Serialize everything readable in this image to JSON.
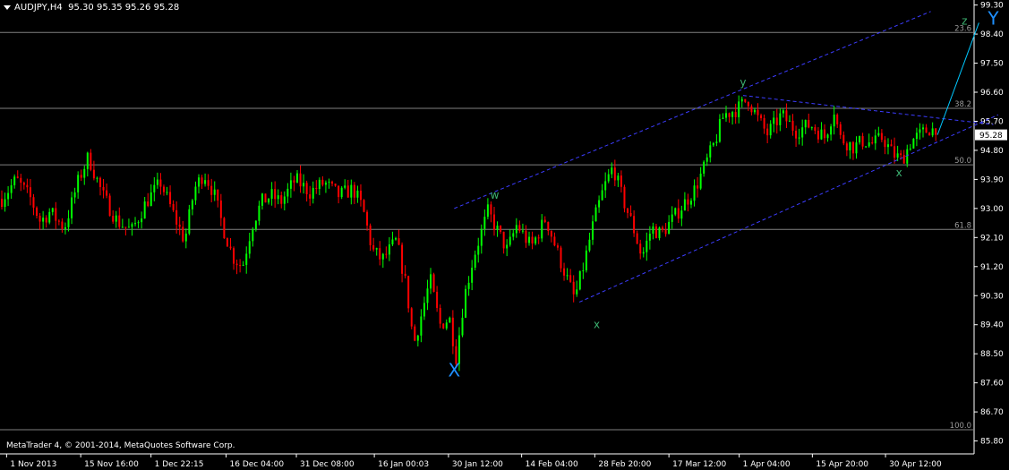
{
  "header": {
    "symbol": "AUDJPY,H4",
    "ohlc": "95.30 95.35 95.26 95.28"
  },
  "copyright": "MetaTrader 4, © 2001-2014, MetaQuotes Software Corp.",
  "colors": {
    "background": "#000000",
    "bull": "#00ff00",
    "bear": "#ff0000",
    "axis": "#ffffff",
    "fib_line": "#808080",
    "channel": "#3c3cff",
    "wave_label_small": "#3cb371",
    "wave_label_big": "#1e90ff",
    "projection": "#00c8ff"
  },
  "chart_data": {
    "type": "candlestick",
    "symbol": "AUDJPY",
    "timeframe": "H4",
    "last_price": "95.28",
    "price_axis": {
      "range": [
        85.4,
        99.4
      ],
      "ticks": [
        "99.30",
        "98.40",
        "97.50",
        "96.60",
        "95.70",
        "94.80",
        "93.90",
        "93.00",
        "92.10",
        "91.20",
        "90.30",
        "89.40",
        "88.50",
        "87.60",
        "86.70",
        "85.80"
      ]
    },
    "time_axis": {
      "range": [
        0,
        101
      ],
      "labels": [
        {
          "t": 0.5,
          "label": "1 Nov 2013"
        },
        {
          "t": 8.2,
          "label": "15 Nov 16:00"
        },
        {
          "t": 15.5,
          "label": "1 Dec 22:15"
        },
        {
          "t": 23.3,
          "label": "16 Dec 04:00"
        },
        {
          "t": 30.6,
          "label": "31 Dec 08:00"
        },
        {
          "t": 38.7,
          "label": "16 Jan 00:03"
        },
        {
          "t": 46.4,
          "label": "30 Jan 12:00"
        },
        {
          "t": 54.0,
          "label": "14 Feb 04:00"
        },
        {
          "t": 61.6,
          "label": "28 Feb 20:00"
        },
        {
          "t": 69.3,
          "label": "17 Mar 12:00"
        },
        {
          "t": 76.6,
          "label": "1 Apr 04:00"
        },
        {
          "t": 84.2,
          "label": "15 Apr 20:00"
        },
        {
          "t": 91.8,
          "label": "30 Apr 12:00"
        }
      ]
    },
    "fib_levels": [
      {
        "label": "23.6",
        "price": 98.45
      },
      {
        "label": "38.2",
        "price": 96.1
      },
      {
        "label": "50.0",
        "price": 94.35
      },
      {
        "label": "61.8",
        "price": 92.35
      },
      {
        "label": "100.0",
        "price": 86.15
      }
    ],
    "price_path": [
      [
        0,
        93.3
      ],
      [
        1.5,
        93.9
      ],
      [
        3,
        93.3
      ],
      [
        4,
        92.6
      ],
      [
        5,
        92.9
      ],
      [
        6.5,
        92.4
      ],
      [
        8,
        93.9
      ],
      [
        9,
        94.6
      ],
      [
        10.5,
        93.4
      ],
      [
        12,
        92.6
      ],
      [
        13.5,
        92.3
      ],
      [
        15,
        93.2
      ],
      [
        16.5,
        93.8
      ],
      [
        18,
        92.7
      ],
      [
        19,
        92.0
      ],
      [
        20,
        93.6
      ],
      [
        21,
        94.1
      ],
      [
        22,
        93.5
      ],
      [
        23,
        92.4
      ],
      [
        24,
        91.5
      ],
      [
        25,
        91.2
      ],
      [
        26,
        92.5
      ],
      [
        27,
        93.2
      ],
      [
        28,
        93.4
      ],
      [
        29,
        93.2
      ],
      [
        30.5,
        93.9
      ],
      [
        32,
        93.5
      ],
      [
        33.5,
        93.8
      ],
      [
        35,
        93.4
      ],
      [
        36.5,
        93.6
      ],
      [
        37.5,
        93.0
      ],
      [
        38.5,
        91.7
      ],
      [
        39.5,
        91.4
      ],
      [
        41,
        92.0
      ],
      [
        42,
        90.6
      ],
      [
        42.8,
        88.8
      ],
      [
        43.5,
        89.6
      ],
      [
        44.5,
        90.8
      ],
      [
        45.5,
        89.4
      ],
      [
        46.5,
        89.6
      ],
      [
        47.2,
        88.4
      ],
      [
        48,
        90.2
      ],
      [
        49,
        91.5
      ],
      [
        50.5,
        92.9
      ],
      [
        51.5,
        92.3
      ],
      [
        52.5,
        91.7
      ],
      [
        53.5,
        92.5
      ],
      [
        55,
        91.8
      ],
      [
        56.5,
        92.7
      ],
      [
        58,
        91.4
      ],
      [
        59.5,
        90.2
      ],
      [
        60.5,
        91.3
      ],
      [
        61.5,
        92.6
      ],
      [
        62.5,
        93.6
      ],
      [
        63.5,
        94.3
      ],
      [
        64.5,
        93.3
      ],
      [
        65.5,
        92.5
      ],
      [
        66.5,
        91.5
      ],
      [
        67.5,
        92.4
      ],
      [
        68.5,
        92.2
      ],
      [
        69.5,
        92.6
      ],
      [
        71,
        93.2
      ],
      [
        72,
        93.6
      ],
      [
        73,
        94.3
      ],
      [
        74,
        95.0
      ],
      [
        75,
        95.9
      ],
      [
        76.5,
        96.1
      ],
      [
        77.5,
        96.4
      ],
      [
        78.5,
        95.8
      ],
      [
        79.5,
        95.3
      ],
      [
        81,
        95.9
      ],
      [
        82.5,
        95.4
      ],
      [
        84,
        95.6
      ],
      [
        85.5,
        95.2
      ],
      [
        86.5,
        96.1
      ],
      [
        87,
        95.2
      ],
      [
        88.5,
        94.9
      ],
      [
        89.5,
        95.1
      ],
      [
        90.5,
        95.0
      ],
      [
        91.5,
        95.2
      ],
      [
        92.5,
        94.7
      ],
      [
        93.5,
        94.5
      ],
      [
        94.5,
        95.1
      ],
      [
        95.5,
        95.3
      ],
      [
        96.5,
        95.5
      ],
      [
        97.2,
        95.28
      ]
    ],
    "channel_lines": [
      {
        "from": [
          47,
          93.0
        ],
        "to": [
          96.5,
          99.1
        ]
      },
      {
        "from": [
          60,
          90.1
        ],
        "to": [
          103.5,
          95.9
        ]
      },
      {
        "from": [
          77,
          96.5
        ],
        "to": [
          103,
          95.6
        ]
      }
    ],
    "projection": {
      "from": [
        97.2,
        95.28
      ],
      "to": [
        101.5,
        98.75
      ]
    },
    "wave_labels": [
      {
        "text": "w",
        "t": 51.2,
        "price": 93.3,
        "size": "small"
      },
      {
        "text": "x",
        "t": 61.8,
        "price": 89.3,
        "size": "small"
      },
      {
        "text": "y",
        "t": 77.0,
        "price": 96.8,
        "size": "small"
      },
      {
        "text": "x",
        "t": 93.2,
        "price": 94.0,
        "size": "small"
      },
      {
        "text": "z",
        "t": 100.0,
        "price": 98.7,
        "size": "small"
      },
      {
        "text": "X",
        "t": 47.0,
        "price": 87.8,
        "size": "big"
      },
      {
        "text": "Y",
        "t": 103.0,
        "price": 98.7,
        "size": "big"
      }
    ]
  }
}
